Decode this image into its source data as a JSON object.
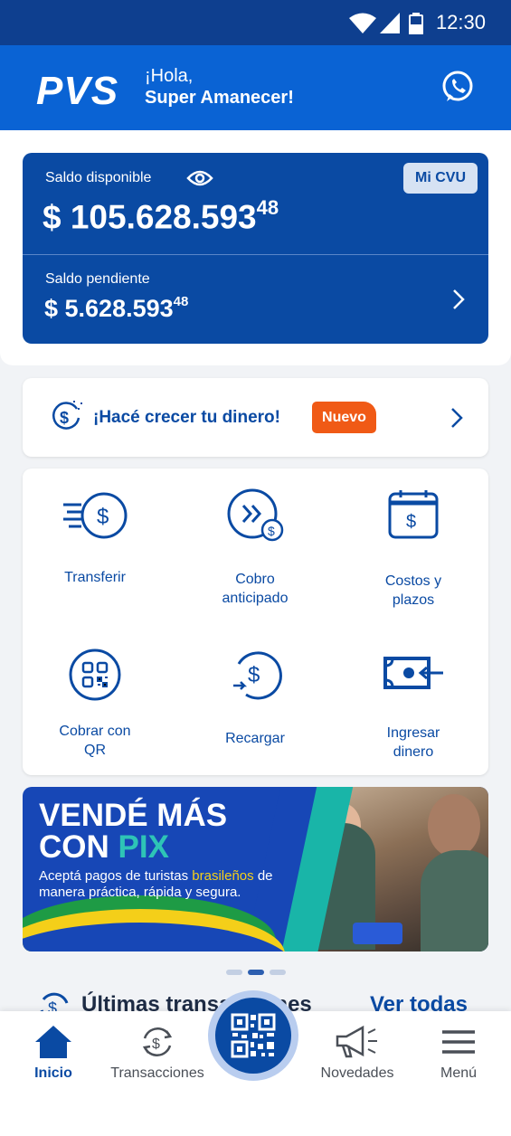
{
  "status_bar": {
    "time": "12:30"
  },
  "header": {
    "logo": "PVS",
    "greeting": "¡Hola,",
    "user_name": "Super Amanecer!",
    "whatsapp_icon": "whatsapp-icon"
  },
  "balance": {
    "available_label": "Saldo disponible",
    "available_amount": "$ 105.628.593",
    "available_cents": "48",
    "cvu_button": "Mi CVU",
    "pending_label": "Saldo pendiente",
    "pending_amount": "$ 5.628.593",
    "pending_cents": "48"
  },
  "promo": {
    "text": "¡Hacé crecer tu dinero!",
    "badge": "Nuevo"
  },
  "actions": [
    {
      "label": "Transferir",
      "icon": "transfer-icon"
    },
    {
      "label": "Cobro anticipado",
      "icon": "advance-payment-icon"
    },
    {
      "label": "Costos y plazos",
      "icon": "calendar-icon"
    },
    {
      "label": "Cobrar con QR",
      "icon": "qr-icon"
    },
    {
      "label": "Recargar",
      "icon": "recharge-icon"
    },
    {
      "label": "Ingresar dinero",
      "icon": "cash-in-icon"
    }
  ],
  "banner": {
    "title_line1": "VENDÉ MÁS",
    "title_line2_a": "CON ",
    "title_line2_b": "PIX",
    "subtitle_a": "Aceptá pagos de turistas ",
    "subtitle_highlight": "brasileños",
    "subtitle_b": " de manera práctica, rápida y segura."
  },
  "carousel": {
    "active_index": 1,
    "count": 3
  },
  "last_transactions": {
    "title": "Últimas transacciones",
    "link": "Ver todas"
  },
  "nav": {
    "items": [
      {
        "label": "Inicio",
        "icon": "home-icon"
      },
      {
        "label": "Transacciones",
        "icon": "transactions-icon"
      },
      {
        "label": "Novedades",
        "icon": "megaphone-icon"
      },
      {
        "label": "Menú",
        "icon": "hamburger-icon"
      }
    ],
    "center_icon": "qr-code-icon"
  },
  "colors": {
    "primary": "#0a4aa3",
    "header": "#0a63d4",
    "statusbar": "#0e3f8f",
    "badge": "#f05a16",
    "pix": "#2ec4b6"
  }
}
